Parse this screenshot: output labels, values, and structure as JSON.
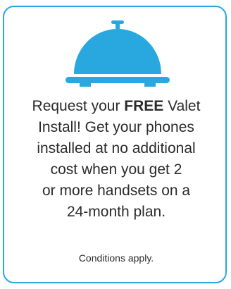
{
  "colors": {
    "accent": "#29a8e0",
    "text": "#2b2b2b"
  },
  "icon": {
    "name": "service-bell-icon"
  },
  "message": {
    "line1_prefix": "Request your ",
    "line1_bold": "FREE",
    "line1_suffix": " Valet",
    "line2": "Install! Get your phones",
    "line3": "installed at no additional",
    "line4": "cost when you get 2",
    "line5": "or more handsets on a",
    "line6": "24-month plan."
  },
  "note": "Conditions apply."
}
